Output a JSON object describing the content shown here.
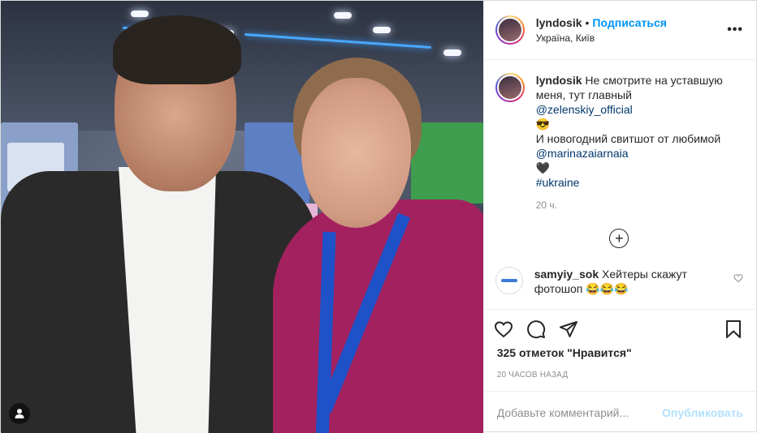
{
  "header": {
    "username": "lyndosik",
    "separator": "•",
    "follow_label": "Подписаться",
    "location": "Україна, Київ",
    "more_label": "•••"
  },
  "caption": {
    "username": "lyndosik",
    "line1": "Не смотрите на уставшую меня, тут главный",
    "mention1": "@zelenskiy_official",
    "emoji1": "😎",
    "line2": "И новогодний свитшот от любимой",
    "mention2": "@marinazaiarnaia",
    "emoji2": "🖤",
    "hashtag": "#ukraine",
    "time": "20 ч."
  },
  "load_more_label": "+",
  "comment": {
    "username": "samyiy_sok",
    "text": "Хейтеры скажут фотошоп 😂😂😂"
  },
  "likes_text": "325 отметок \"Нравится\"",
  "posted_ago": "20 ЧАСОВ НАЗАД",
  "add_comment": {
    "placeholder": "Добавьте комментарий...",
    "publish_label": "Опубликовать"
  },
  "colors": {
    "accent": "#0095f6",
    "publish_disabled": "#b2dffc",
    "link": "#00376b"
  }
}
